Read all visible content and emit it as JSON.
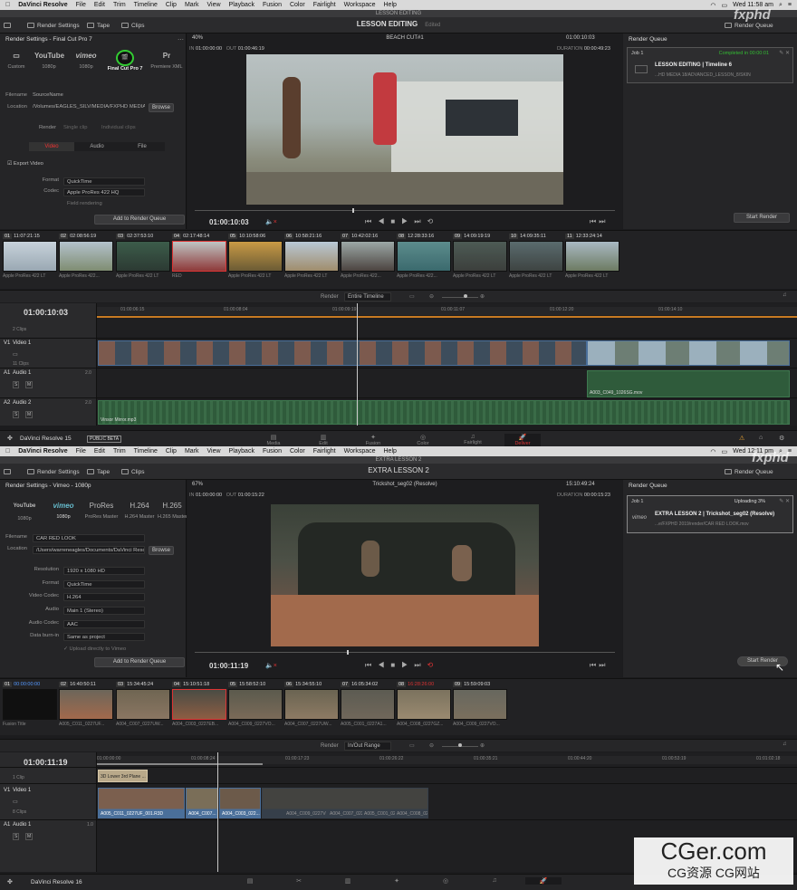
{
  "top": {
    "menubar": [
      "DaVinci Resolve",
      "File",
      "Edit",
      "Trim",
      "Timeline",
      "Clip",
      "Mark",
      "View",
      "Playback",
      "Fusion",
      "Color",
      "Fairlight",
      "Workspace",
      "Help"
    ],
    "clock": "Wed 11:58 am",
    "window_title": "LESSON EDITING",
    "toolbar": {
      "render_settings": "Render Settings",
      "tape": "Tape",
      "clips": "Clips",
      "project": "LESSON EDITING",
      "edited": "Edited",
      "render_queue": "Render Queue"
    },
    "panel_title": "Render Settings - Final Cut Pro 7",
    "presets": [
      "Custom",
      "1080p",
      "1080p",
      "Final Cut Pro 7",
      "Premiere XML"
    ],
    "preset_logos": [
      "",
      "YouTube",
      "vimeo",
      "",
      "Pr"
    ],
    "filename_label": "Filename",
    "filename_value": "SourceName",
    "location_label": "Location",
    "location_value": "/Volumes/EAGLES_SILV/MEDIA/FXPHD MEDIA 18/",
    "browse": "Browse",
    "render_label": "Render",
    "single_clip": "Single clip",
    "individual_clips": "Individual clips",
    "tabs": [
      "Video",
      "Audio",
      "File"
    ],
    "export_video": "Export Video",
    "format_label": "Format",
    "format_value": "QuickTime",
    "codec_label": "Codec",
    "codec_value": "Apple ProRes 422 HQ",
    "field_rendering": "Field rendering",
    "add_queue": "Add to Render Queue",
    "zoom": "40%",
    "clip_name": "BEACH CUT#1",
    "timecode_top": "01:00:10:03",
    "in_label": "IN",
    "in_value": "01:00:00:00",
    "out_label": "OUT",
    "out_value": "01:00:46:19",
    "duration_label": "DURATION",
    "duration_value": "00:00:49:23",
    "viewer_tc": "01:00:10:03",
    "queue_title": "Render Queue",
    "job": "Job 1",
    "job_status": "Completed in 00:00:01",
    "job_name": "LESSON EDITING | Timeline 6",
    "job_path": "...HD MEDIA 18/ADVANCED_LESSON_8/SKIN",
    "start_render": "Start Render",
    "clips": [
      {
        "num": "01",
        "tc": "11:07:21:15",
        "codec": "Apple ProRes 422 LT"
      },
      {
        "num": "02",
        "tc": "02:08:56:19",
        "codec": "Apple ProRes 422..."
      },
      {
        "num": "03",
        "tc": "02:37:53:10",
        "codec": "Apple ProRes 422 LT"
      },
      {
        "num": "04",
        "tc": "02:17:48:14",
        "codec": "RED"
      },
      {
        "num": "05",
        "tc": "10:10:58:06",
        "codec": "Apple ProRes 422 LT"
      },
      {
        "num": "06",
        "tc": "10:58:21:16",
        "codec": "Apple ProRes 422 LT"
      },
      {
        "num": "07",
        "tc": "10:42:02:16",
        "codec": "Apple ProRes 422..."
      },
      {
        "num": "08",
        "tc": "12:28:33:16",
        "codec": "Apple ProRes 422..."
      },
      {
        "num": "09",
        "tc": "14:09:19:19",
        "codec": "Apple ProRes 422 LT"
      },
      {
        "num": "10",
        "tc": "14:09:35:11",
        "codec": "Apple ProRes 422 LT"
      },
      {
        "num": "11",
        "tc": "12:33:24:14",
        "codec": "Apple ProRes 422 LT"
      }
    ],
    "render_mode_label": "Render",
    "render_mode": "Entire Timeline",
    "tl_tc": "01:00:10:03",
    "ruler": [
      "01:00:06:15",
      "01:00:08:04",
      "01:00:09:19",
      "01:00:11:07",
      "01:00:12:20",
      "01:00:14:10"
    ],
    "clips_count": "2 Clips",
    "v1_clips": "11 Clips",
    "tracks": [
      {
        "id": "V1",
        "name": "Video 1"
      },
      {
        "id": "A1",
        "name": "Audio 1",
        "level": "2.0"
      },
      {
        "id": "A2",
        "name": "Audio 2",
        "level": "2.0"
      }
    ],
    "a1_clip": "A003_C049_1026SG.mov",
    "a2_clip": "Vinsor Mirror.mp3",
    "brand": "DaVinci Resolve 15",
    "beta": "PUBLIC BETA",
    "pages": [
      "Media",
      "Edit",
      "Fusion",
      "Color",
      "Fairlight",
      "Deliver"
    ]
  },
  "bottom": {
    "menubar": [
      "DaVinci Resolve",
      "File",
      "Edit",
      "Trim",
      "Timeline",
      "Clip",
      "Mark",
      "View",
      "Playback",
      "Fusion",
      "Color",
      "Fairlight",
      "Workspace",
      "Help"
    ],
    "clock": "Wed 12:11 pm",
    "window_title": "EXTRA LESSON 2",
    "toolbar": {
      "render_settings": "Render Settings",
      "tape": "Tape",
      "clips": "Clips",
      "project": "EXTRA LESSON 2",
      "render_queue": "Render Queue"
    },
    "panel_title": "Render Settings - Vimeo - 1080p",
    "presets": [
      "1080p",
      "1080p",
      "ProRes Master",
      "H.264 Master",
      "H.265 Master"
    ],
    "preset_logos": [
      "YouTube",
      "vimeo",
      "ProRes",
      "H.264",
      "H.265"
    ],
    "filename_label": "Filename",
    "filename_value": "CAR RED LOOK",
    "location_label": "Location",
    "location_value": "/Users/warreneagles/Documents/DaVinci Reso",
    "browse": "Browse",
    "rows": [
      {
        "label": "Resolution",
        "value": "1920 x 1080 HD"
      },
      {
        "label": "Format",
        "value": "QuickTime"
      },
      {
        "label": "Video Codec",
        "value": "H.264"
      },
      {
        "label": "Audio",
        "value": "Main 1 (Stereo)"
      },
      {
        "label": "Audio Codec",
        "value": "AAC"
      },
      {
        "label": "Data burn-in",
        "value": "Same as project"
      }
    ],
    "upload": "Upload directly to Vimeo",
    "add_queue": "Add to Render Queue",
    "zoom": "67%",
    "clip_name": "Trickshot_seg02 (Resolve)",
    "timecode_top": "15:10:49:24",
    "in_label": "IN",
    "in_value": "01:00:00:00",
    "out_label": "OUT",
    "out_value": "01:00:15:22",
    "duration_label": "DURATION",
    "duration_value": "00:00:15:23",
    "viewer_tc": "01:00:11:19",
    "queue_title": "Render Queue",
    "job": "Job 1",
    "job_status": "Uploading 3%",
    "job_name": "EXTRA LESSON 2 | Trickshot_seg02 (Resolve)",
    "job_path": "...e/FXPHD 2019/render/CAR RED LOOK.mov",
    "job_logo": "vimeo",
    "start_render": "Start Render",
    "clips": [
      {
        "num": "01",
        "tc": "00:00:00:00",
        "codec": "Fusion Title"
      },
      {
        "num": "02",
        "tc": "16:40:50:11",
        "codec": "A005_C011_0227UF..."
      },
      {
        "num": "03",
        "tc": "15:34:45:24",
        "codec": "A004_C007_0227UW..."
      },
      {
        "num": "04",
        "tc": "15:10:51:18",
        "codec": "A004_C003_0227EB..."
      },
      {
        "num": "05",
        "tc": "15:58:52:10",
        "codec": "A004_C009_0227VO..."
      },
      {
        "num": "06",
        "tc": "15:34:55:10",
        "codec": "A004_C007_0227UW..."
      },
      {
        "num": "07",
        "tc": "16:05:34:02",
        "codec": "A005_C001_0227A1..."
      },
      {
        "num": "08",
        "tc": "16:28:26:00",
        "codec": "A004_C008_0227GZ..."
      },
      {
        "num": "09",
        "tc": "15:59:09:03",
        "codec": "A004_C009_0227VO..."
      }
    ],
    "render_mode_label": "Render",
    "render_mode": "In/Out Range",
    "tl_tc": "01:00:11:19",
    "ruler": [
      "01:00:00:00",
      "01:00:08:24",
      "01:00:17:23",
      "01:00:26:22",
      "01:00:35:21",
      "01:00:44:20",
      "01:00:53:19",
      "01:01:02:18"
    ],
    "v2_clips": "1 Clip",
    "v2_clip": "3D Lower 3rd Plane ...",
    "v1_clips": "8 Clips",
    "tracks": [
      {
        "id": "V1",
        "name": "Video 1"
      },
      {
        "id": "A1",
        "name": "Audio 1",
        "level": "1.0"
      }
    ],
    "v1_clip_names": [
      "A005_C011_0227UF_001.R3D",
      "A004_C007...",
      "A004_C003_022...",
      "A004_C009_0227VO...",
      "A004_C007_0227...",
      "A005_C001_0227...",
      "A004_C008_0227...",
      "A004_C009_02..."
    ],
    "brand": "DaVinci Resolve 16"
  },
  "watermark": {
    "main": "CGer.com",
    "sub": "CG资源  CG网站",
    "fx": "fxphd"
  },
  "colors": {
    "accent_red": "#d33333",
    "clip_bar": "#4a6f9a",
    "audio_green": "#2f5b3b",
    "playhead": "#c8c8c8"
  }
}
